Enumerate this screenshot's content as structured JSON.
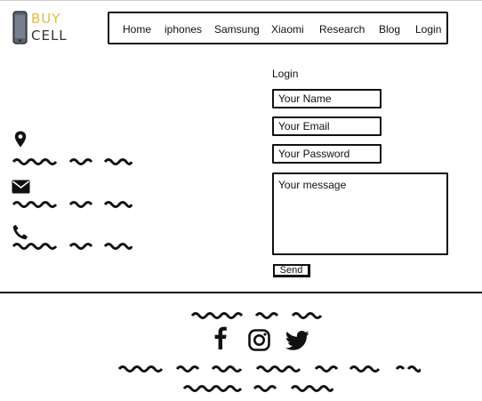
{
  "logo": {
    "line1": "BUY",
    "line2": "CELL"
  },
  "nav": {
    "items": [
      {
        "label": "Home"
      },
      {
        "label": "iphones"
      },
      {
        "label": "Samsung"
      },
      {
        "label": "Xiaomi"
      },
      {
        "label": "Research"
      },
      {
        "label": "Blog"
      },
      {
        "label": "Login"
      }
    ]
  },
  "contact_icons": [
    "map-marker-icon",
    "envelope-icon",
    "phone-icon"
  ],
  "form": {
    "title": "Login",
    "name_placeholder": "Your Name",
    "email_placeholder": "Your Email",
    "password_placeholder": "Your Password",
    "message_placeholder": "Your message",
    "send_label": "Send"
  },
  "footer": {
    "social_icons": [
      "facebook-icon",
      "instagram-icon",
      "twitter-icon"
    ]
  },
  "colors": {
    "brand_accent": "#e2b84a",
    "ink": "#111111"
  }
}
